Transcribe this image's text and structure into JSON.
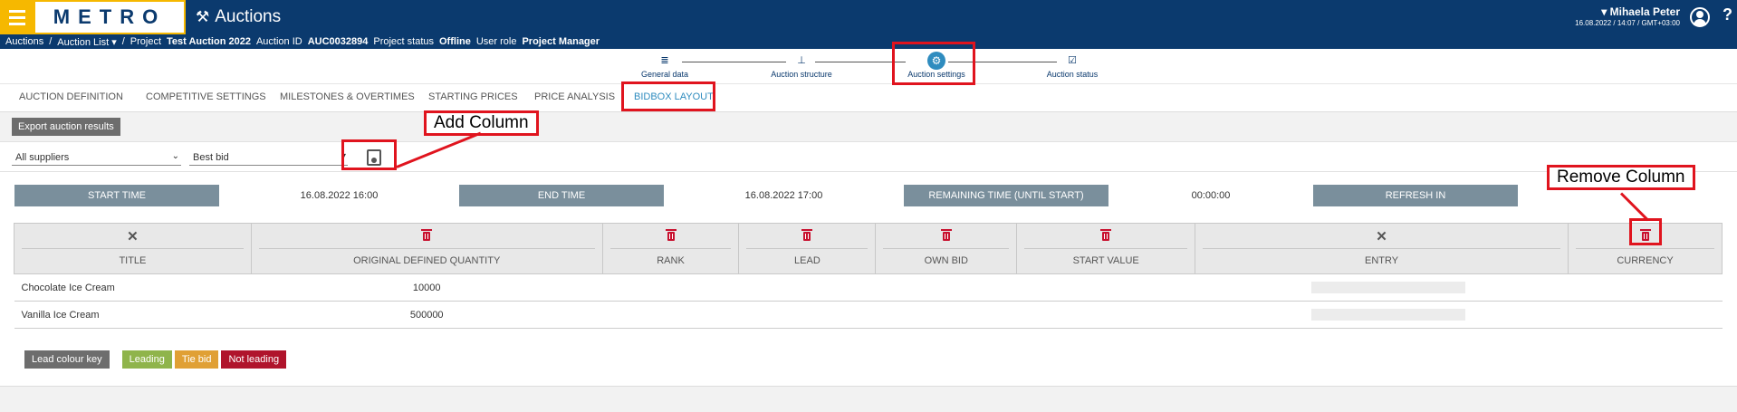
{
  "header": {
    "logo": "METRO",
    "app_title": "Auctions",
    "user_name": "Mihaela Peter",
    "user_datetime": "16.08.2022 / 14:07 / GMT+03:00",
    "help": "?"
  },
  "breadcrumb": {
    "root": "Auctions",
    "list": "Auction List",
    "project_label": "Project",
    "project_value": "Test Auction 2022",
    "auction_id_label": "Auction ID",
    "auction_id_value": "AUC0032894",
    "status_label": "Project status",
    "status_value": "Offline",
    "role_label": "User role",
    "role_value": "Project Manager"
  },
  "stepper": [
    {
      "label": "General data",
      "icon": "database-icon"
    },
    {
      "label": "Auction structure",
      "icon": "hierarchy-icon"
    },
    {
      "label": "Auction settings",
      "icon": "gear-icon"
    },
    {
      "label": "Auction status",
      "icon": "checkbox-icon"
    }
  ],
  "tabs": [
    "AUCTION DEFINITION",
    "COMPETITIVE SETTINGS",
    "MILESTONES & OVERTIMES",
    "STARTING PRICES",
    "PRICE ANALYSIS",
    "BIDBOX LAYOUT"
  ],
  "active_tab": "BIDBOX LAYOUT",
  "toolbar": {
    "export_label": "Export auction results"
  },
  "filters": {
    "supplier": "All suppliers",
    "bid": "Best bid"
  },
  "timers": {
    "start_label": "START TIME",
    "start_value": "16.08.2022 16:00",
    "end_label": "END TIME",
    "end_value": "16.08.2022 17:00",
    "remaining_label": "REMAINING TIME (UNTIL START)",
    "remaining_value": "00:00:00",
    "refresh_label": "REFRESH IN"
  },
  "columns": [
    "TITLE",
    "ORIGINAL DEFINED QUANTITY",
    "RANK",
    "LEAD",
    "OWN BID",
    "START VALUE",
    "ENTRY",
    "CURRENCY"
  ],
  "rows": [
    {
      "title": "Chocolate Ice Cream",
      "quantity": "10000"
    },
    {
      "title": "Vanilla Ice Cream",
      "quantity": "500000"
    }
  ],
  "legend": {
    "key": "Lead colour key",
    "leading": "Leading",
    "tie": "Tie bid",
    "not_leading": "Not leading"
  },
  "annotations": {
    "add_column": "Add Column",
    "remove_column": "Remove Column"
  },
  "colors": {
    "header": "#0b3a6e",
    "accent": "#f6b800",
    "highlight": "#e0141e",
    "tab_active": "#2f8cbf"
  }
}
